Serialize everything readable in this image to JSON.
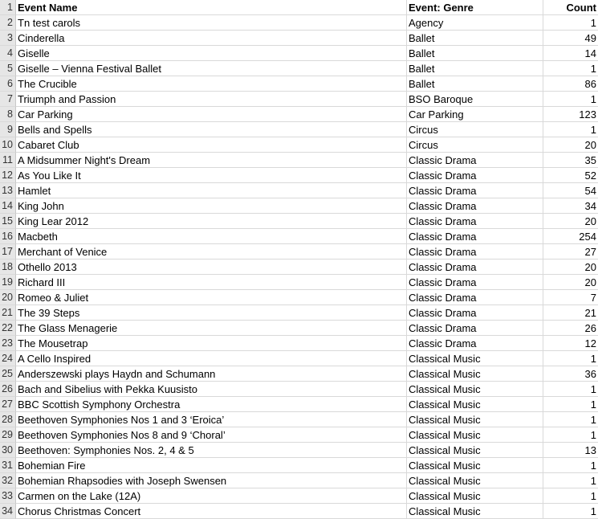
{
  "header": {
    "row_number": "1",
    "col_a": "Event Name",
    "col_b": "Event: Genre",
    "col_c": "Count"
  },
  "rows": [
    {
      "n": "2",
      "name": "Tn test carols",
      "genre": "Agency",
      "count": "1"
    },
    {
      "n": "3",
      "name": "Cinderella",
      "genre": "Ballet",
      "count": "49"
    },
    {
      "n": "4",
      "name": "Giselle",
      "genre": "Ballet",
      "count": "14"
    },
    {
      "n": "5",
      "name": "Giselle – Vienna Festival Ballet",
      "genre": "Ballet",
      "count": "1"
    },
    {
      "n": "6",
      "name": "The Crucible",
      "genre": "Ballet",
      "count": "86"
    },
    {
      "n": "7",
      "name": "Triumph and Passion",
      "genre": "BSO Baroque",
      "count": "1"
    },
    {
      "n": "8",
      "name": "Car Parking",
      "genre": "Car Parking",
      "count": "123"
    },
    {
      "n": "9",
      "name": "Bells and Spells",
      "genre": "Circus",
      "count": "1"
    },
    {
      "n": "10",
      "name": "Cabaret Club",
      "genre": "Circus",
      "count": "20"
    },
    {
      "n": "11",
      "name": "A Midsummer Night's Dream",
      "genre": "Classic Drama",
      "count": "35"
    },
    {
      "n": "12",
      "name": "As You Like It",
      "genre": "Classic Drama",
      "count": "52"
    },
    {
      "n": "13",
      "name": "Hamlet",
      "genre": "Classic Drama",
      "count": "54"
    },
    {
      "n": "14",
      "name": "King John",
      "genre": "Classic Drama",
      "count": "34"
    },
    {
      "n": "15",
      "name": "King Lear 2012",
      "genre": "Classic Drama",
      "count": "20"
    },
    {
      "n": "16",
      "name": "Macbeth",
      "genre": "Classic Drama",
      "count": "254"
    },
    {
      "n": "17",
      "name": "Merchant of Venice",
      "genre": "Classic Drama",
      "count": "27"
    },
    {
      "n": "18",
      "name": "Othello 2013",
      "genre": "Classic Drama",
      "count": "20"
    },
    {
      "n": "19",
      "name": "Richard III",
      "genre": "Classic Drama",
      "count": "20"
    },
    {
      "n": "20",
      "name": "Romeo & Juliet",
      "genre": "Classic Drama",
      "count": "7"
    },
    {
      "n": "21",
      "name": "The 39 Steps",
      "genre": "Classic Drama",
      "count": "21"
    },
    {
      "n": "22",
      "name": "The Glass Menagerie",
      "genre": "Classic Drama",
      "count": "26"
    },
    {
      "n": "23",
      "name": "The Mousetrap",
      "genre": "Classic Drama",
      "count": "12"
    },
    {
      "n": "24",
      "name": "A Cello Inspired",
      "genre": "Classical Music",
      "count": "1"
    },
    {
      "n": "25",
      "name": "Anderszewski plays Haydn and Schumann",
      "genre": "Classical Music",
      "count": "36"
    },
    {
      "n": "26",
      "name": "Bach and Sibelius with Pekka Kuusisto",
      "genre": "Classical Music",
      "count": "1"
    },
    {
      "n": "27",
      "name": "BBC Scottish Symphony Orchestra",
      "genre": "Classical Music",
      "count": "1"
    },
    {
      "n": "28",
      "name": "Beethoven Symphonies Nos 1 and 3 ‘Eroica’",
      "genre": "Classical Music",
      "count": "1"
    },
    {
      "n": "29",
      "name": "Beethoven Symphonies Nos 8 and 9 ‘Choral’",
      "genre": "Classical Music",
      "count": "1"
    },
    {
      "n": "30",
      "name": "Beethoven: Symphonies Nos. 2, 4 & 5",
      "genre": "Classical Music",
      "count": "13"
    },
    {
      "n": "31",
      "name": "Bohemian Fire",
      "genre": "Classical Music",
      "count": "1"
    },
    {
      "n": "32",
      "name": "Bohemian Rhapsodies with Joseph Swensen",
      "genre": "Classical Music",
      "count": "1"
    },
    {
      "n": "33",
      "name": "Carmen on the Lake (12A)",
      "genre": "Classical Music",
      "count": "1"
    },
    {
      "n": "34",
      "name": "Chorus Christmas Concert",
      "genre": "Classical Music",
      "count": "1"
    }
  ]
}
